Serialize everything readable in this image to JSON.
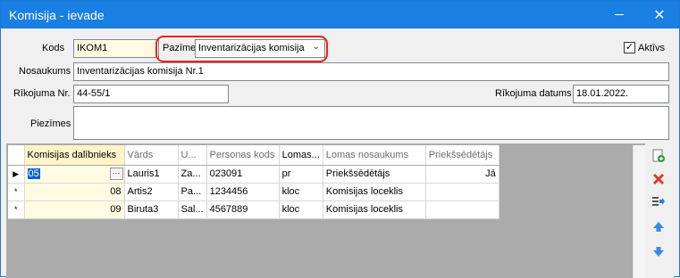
{
  "window": {
    "title": "Komisija - ievade",
    "minimize_label": "",
    "close_label": "✕"
  },
  "form": {
    "kods_label": "Kods",
    "kods_value": "IKOM1",
    "pazime_label": "Pazīme",
    "pazime_value": "Inventarizācijas komisija",
    "aktivs_label": "Aktīvs",
    "aktivs_checked": true,
    "nosaukums_label": "Nosaukums",
    "nosaukums_value": "Inventarizācijas komisija Nr.1",
    "rikojuma_nr_label": "Rīkojuma Nr.",
    "rikojuma_nr_value": "44-55/1",
    "rikojuma_datums_label": "Rīkojuma datums",
    "rikojuma_datums_value": "18.01.2022.",
    "piezimes_label": "Piezīmes",
    "piezimes_value": ""
  },
  "grid": {
    "columns": [
      "Komisijas dalībnieks",
      "Vārds",
      "U...",
      "Personas kods",
      "Lomas...",
      "Lomas nosaukums",
      "Priekšsēdētājs"
    ],
    "rows": [
      {
        "indicator": "▶",
        "member": "05",
        "vards": "Lauris1",
        "u": "Za...",
        "personas_kods": "023091",
        "loma": "pr",
        "lomas_nosaukums": "Priekšsēdētājs",
        "priekssedetajs": "Jā"
      },
      {
        "indicator": "*",
        "member": "08",
        "vards": "Artis2",
        "u": "Pa...",
        "personas_kods": "1234456",
        "loma": "kloc",
        "lomas_nosaukums": "Komisijas loceklis",
        "priekssedetajs": ""
      },
      {
        "indicator": "*",
        "member": "09",
        "vards": "Biruta3",
        "u": "Sal...",
        "personas_kods": "4567889",
        "loma": "kloc",
        "lomas_nosaukums": "Komisijas loceklis",
        "priekssedetajs": ""
      }
    ],
    "ellipsis_label": "···"
  },
  "toolbar": {
    "icons": [
      "add-row-icon",
      "delete-row-icon",
      "insert-row-icon",
      "move-up-icon",
      "move-down-icon"
    ]
  },
  "colors": {
    "titlebar": "#1a7fe2",
    "highlight_ring": "#e22222",
    "selection": "#0a64d4",
    "required_field": "#fffbe3"
  }
}
